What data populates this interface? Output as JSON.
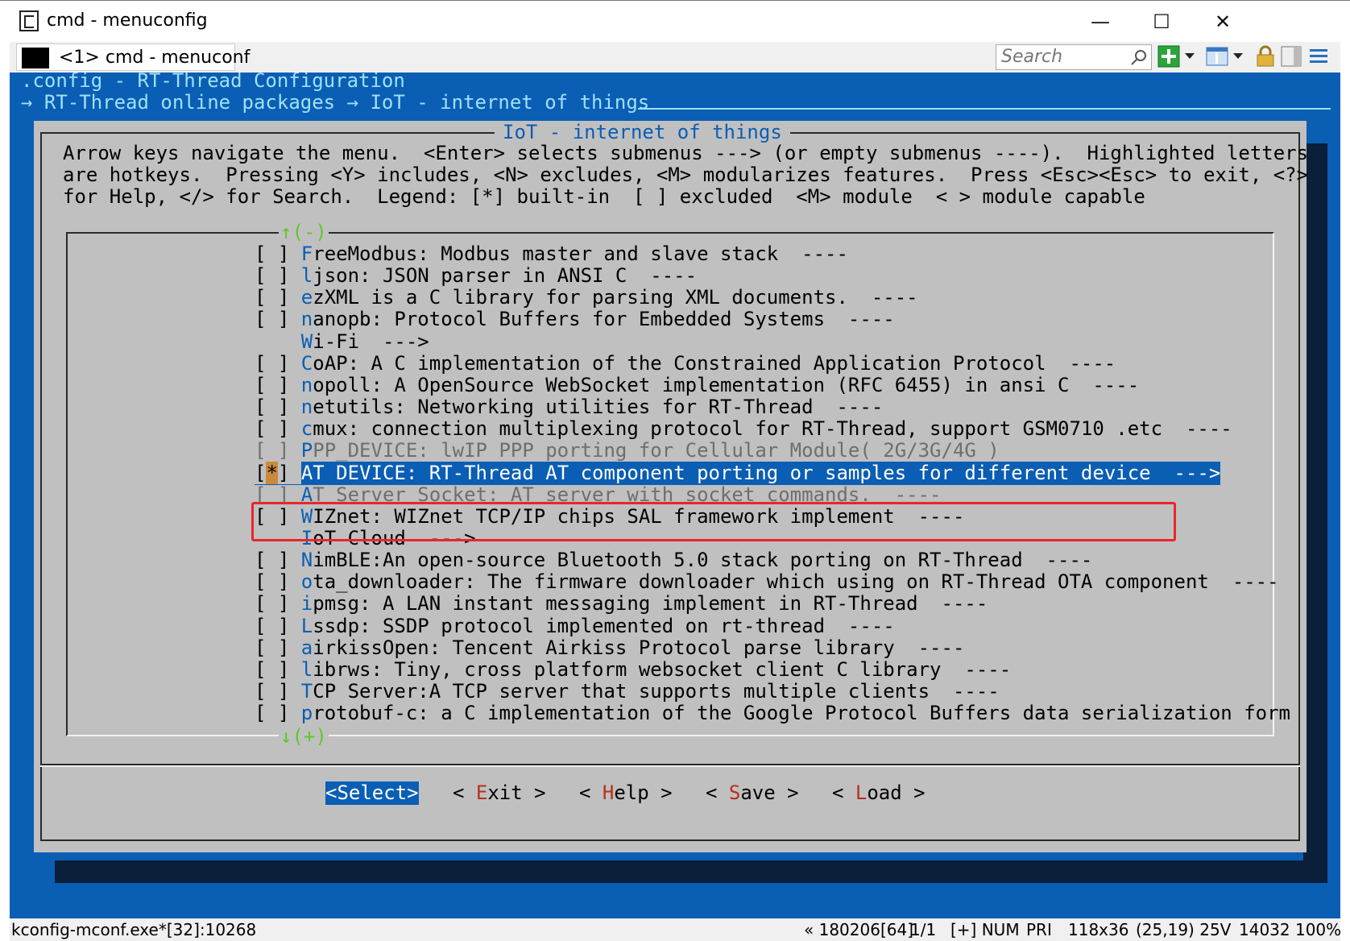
{
  "window": {
    "title": "cmd - menuconfig",
    "min": "—",
    "max": "☐",
    "close": "✕"
  },
  "tab": {
    "label": "<1> cmd - menuconf"
  },
  "search": {
    "placeholder": "Search"
  },
  "console": {
    "header_line1": ".config - RT-Thread Configuration",
    "header_line2": "→ RT-Thread online packages → IoT - internet of things",
    "dialog_title": "IoT - internet of things",
    "help_lines": [
      "Arrow keys navigate the menu.  <Enter> selects submenus ---> (or empty submenus ----).  Highlighted letters",
      "are hotkeys.  Pressing <Y> includes, <N> excludes, <M> modularizes features.  Press <Esc><Esc> to exit, <?>",
      "for Help, </> for Search.  Legend: [*] built-in  [ ] excluded  <M> module  < > module capable"
    ],
    "scroll_up": "↑(-)",
    "scroll_down": "↓(+)",
    "items": [
      {
        "box": "[ ] ",
        "hotkey": "F",
        "rest": "reeModbus: Modbus master and slave stack  ----"
      },
      {
        "box": "[ ] ",
        "hotkey": "l",
        "rest": "json: JSON parser in ANSI C  ----"
      },
      {
        "box": "[ ] ",
        "hotkey": "e",
        "rest": "zXML is a C library for parsing XML documents.  ----"
      },
      {
        "box": "[ ] ",
        "hotkey": "n",
        "rest": "anopb: Protocol Buffers for Embedded Systems  ----"
      },
      {
        "box": "    ",
        "hotkey": "W",
        "rest": "i-Fi  --->"
      },
      {
        "box": "[ ] ",
        "hotkey": "C",
        "rest": "oAP: A C implementation of the Constrained Application Protocol  ----"
      },
      {
        "box": "[ ] ",
        "hotkey": "n",
        "rest": "opoll: A OpenSource WebSocket implementation (RFC 6455) in ansi C  ----"
      },
      {
        "box": "[ ] ",
        "hotkey": "n",
        "rest": "etutils: Networking utilities for RT-Thread  ----"
      },
      {
        "box": "[ ] ",
        "hotkey": "c",
        "rest": "mux: connection multiplexing protocol for RT-Thread, support GSM0710 .etc  ----"
      },
      {
        "box": "[ ] ",
        "hotkey": "P",
        "rest": "PP_DEVICE: lwIP PPP porting for Cellular Module( 2G/3G/4G )"
      },
      {
        "box_pre": "[",
        "box_star": "*",
        "box_post": "] ",
        "hotkey": "A",
        "rest": "T DEVICE: RT-Thread AT component porting or samples for different device  --->"
      },
      {
        "box": "[ ] ",
        "hotkey": "A",
        "rest": "T Server Socket: AT server with socket commands.  ----"
      },
      {
        "box": "[ ] ",
        "hotkey": "W",
        "rest": "IZnet: WIZnet TCP/IP chips SAL framework implement  ----"
      },
      {
        "box": "    ",
        "hotkey": "I",
        "rest": "oT Cloud  --->"
      },
      {
        "box": "[ ] ",
        "hotkey": "N",
        "rest": "imBLE:An open-source Bluetooth 5.0 stack porting on RT-Thread  ----"
      },
      {
        "box": "[ ] ",
        "hotkey": "o",
        "rest": "ta_downloader: The firmware downloader which using on RT-Thread OTA component  ----"
      },
      {
        "box": "[ ] ",
        "hotkey": "i",
        "rest": "pmsg: A LAN instant messaging implement in RT-Thread  ----"
      },
      {
        "box": "[ ] ",
        "hotkey": "L",
        "rest": "ssdp: SSDP protocol implemented on rt-thread  ----"
      },
      {
        "box": "[ ] ",
        "hotkey": "a",
        "rest": "irkissOpen: Tencent Airkiss Protocol parse library  ----"
      },
      {
        "box": "[ ] ",
        "hotkey": "l",
        "rest": "ibrws: Tiny, cross platform websocket client C library  ----"
      },
      {
        "box": "[ ] ",
        "hotkey": "T",
        "rest": "CP Server:A TCP server that supports multiple clients  ----"
      },
      {
        "box": "[ ] ",
        "hotkey": "p",
        "rest": "rotobuf-c: a C implementation of the Google Protocol Buffers data serialization form"
      }
    ],
    "buttons": [
      {
        "pre": "<",
        "hk": "S",
        "post": "elect>"
      },
      {
        "pre": "< ",
        "hk": "E",
        "post": "xit >"
      },
      {
        "pre": "< ",
        "hk": "H",
        "post": "elp >"
      },
      {
        "pre": "< ",
        "hk": "S",
        "post": "ave >"
      },
      {
        "pre": "< ",
        "hk": "L",
        "post": "oad >"
      }
    ]
  },
  "status": {
    "process": "kconfig-mconf.exe*[32]:10268",
    "build": "« 180206[64]",
    "pages": "1/1",
    "keys": "[+] NUM",
    "priority": "PRI",
    "size": "118x36",
    "cursor": "(25,19) 25V",
    "memory": "14032 100%"
  }
}
